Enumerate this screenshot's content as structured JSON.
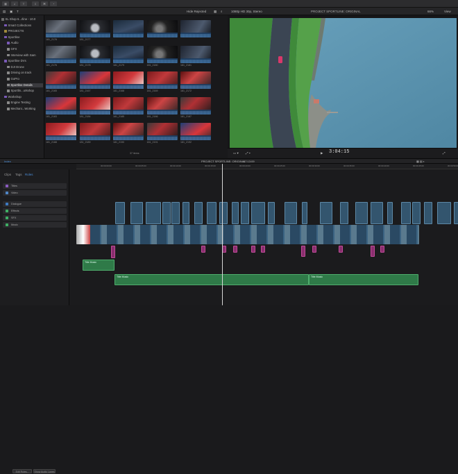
{
  "window": {
    "library_name": "SL Shop 6...rline - 10.0"
  },
  "toolbar": {
    "hide_rejected": "Hide Rejected",
    "format": "1080p HD 30p, Stereo",
    "project_name": "PROJECT SPORTLINE: ORIGINAL",
    "zoom": "66%",
    "view": "View"
  },
  "sidebar": {
    "items": [
      {
        "label": "SL Shop 6...rline - 10.0",
        "indent": 0
      },
      {
        "label": "Smart Collections",
        "indent": 1
      },
      {
        "label": "PROJECTS",
        "indent": 1
      },
      {
        "label": "Sportline",
        "indent": 1
      },
      {
        "label": "Audio",
        "indent": 2
      },
      {
        "label": "GFX",
        "indent": 2
      },
      {
        "label": "Interview with Sam",
        "indent": 2
      },
      {
        "label": "Sportline DVs",
        "indent": 1
      },
      {
        "label": "DJI Drone",
        "indent": 2
      },
      {
        "label": "Driving on track",
        "indent": 2
      },
      {
        "label": "GoPro",
        "indent": 2
      },
      {
        "label": "Sportline Details",
        "indent": 2,
        "selected": true
      },
      {
        "label": "Sportlin...orkshop",
        "indent": 2
      },
      {
        "label": "Workshop",
        "indent": 1
      },
      {
        "label": "Engine Testing",
        "indent": 2
      },
      {
        "label": "Mechani...Working",
        "indent": 2
      }
    ]
  },
  "browser": {
    "thumb_labels": [
      "181_2176",
      "181_2177",
      "",
      "",
      "",
      "181_2176",
      "181_2178",
      "181_2179",
      "181_2180",
      "181_2181",
      "181_2165",
      "181_2167",
      "181_2168",
      "181_2169",
      "181_2172",
      "181_2183",
      "181_2184",
      "181_2185",
      "181_2186",
      "181_2187",
      "181_2188",
      "181_2189",
      "181_2190",
      "181_2191",
      "181_2192"
    ],
    "status": "37 items"
  },
  "viewer": {
    "timecode": "3:04:15"
  },
  "timeline": {
    "header_left": "Index",
    "project": "PROJECT SPORTLINE: ORIGINAL",
    "duration": "07:13:09",
    "ruler_ticks": [
      "00:00:00:00",
      "00:00:05:00",
      "00:00:10:00",
      "00:00:15:00",
      "00:00:20:00",
      "00:00:25:00",
      "00:00:30:00",
      "00:00:35:00",
      "00:00:40:00",
      "00:00:45:00",
      "00:00:50:00"
    ]
  },
  "index": {
    "tabs": [
      "Clips",
      "Tags",
      "Roles"
    ],
    "roles": [
      {
        "label": "Titles",
        "color": "#8a5bc0"
      },
      {
        "label": "Video",
        "color": "#4f86c6"
      },
      {
        "label": "Dialogue",
        "color": "#3d79c0"
      },
      {
        "label": "Effects",
        "color": "#3fae64"
      },
      {
        "label": "SFX",
        "color": "#3fae64"
      },
      {
        "label": "Music",
        "color": "#3fae64"
      }
    ],
    "edit_roles": "Edit Roles...",
    "show_audio_lanes": "Show Audio Lanes"
  },
  "audio_clips": {
    "music_a": "Title Music",
    "music_b": "Title Music",
    "music_c": "Title Music"
  },
  "colors": {
    "accent": "#4c8ed9",
    "music": "#2f7a48",
    "connected": "#8a2e6e"
  }
}
